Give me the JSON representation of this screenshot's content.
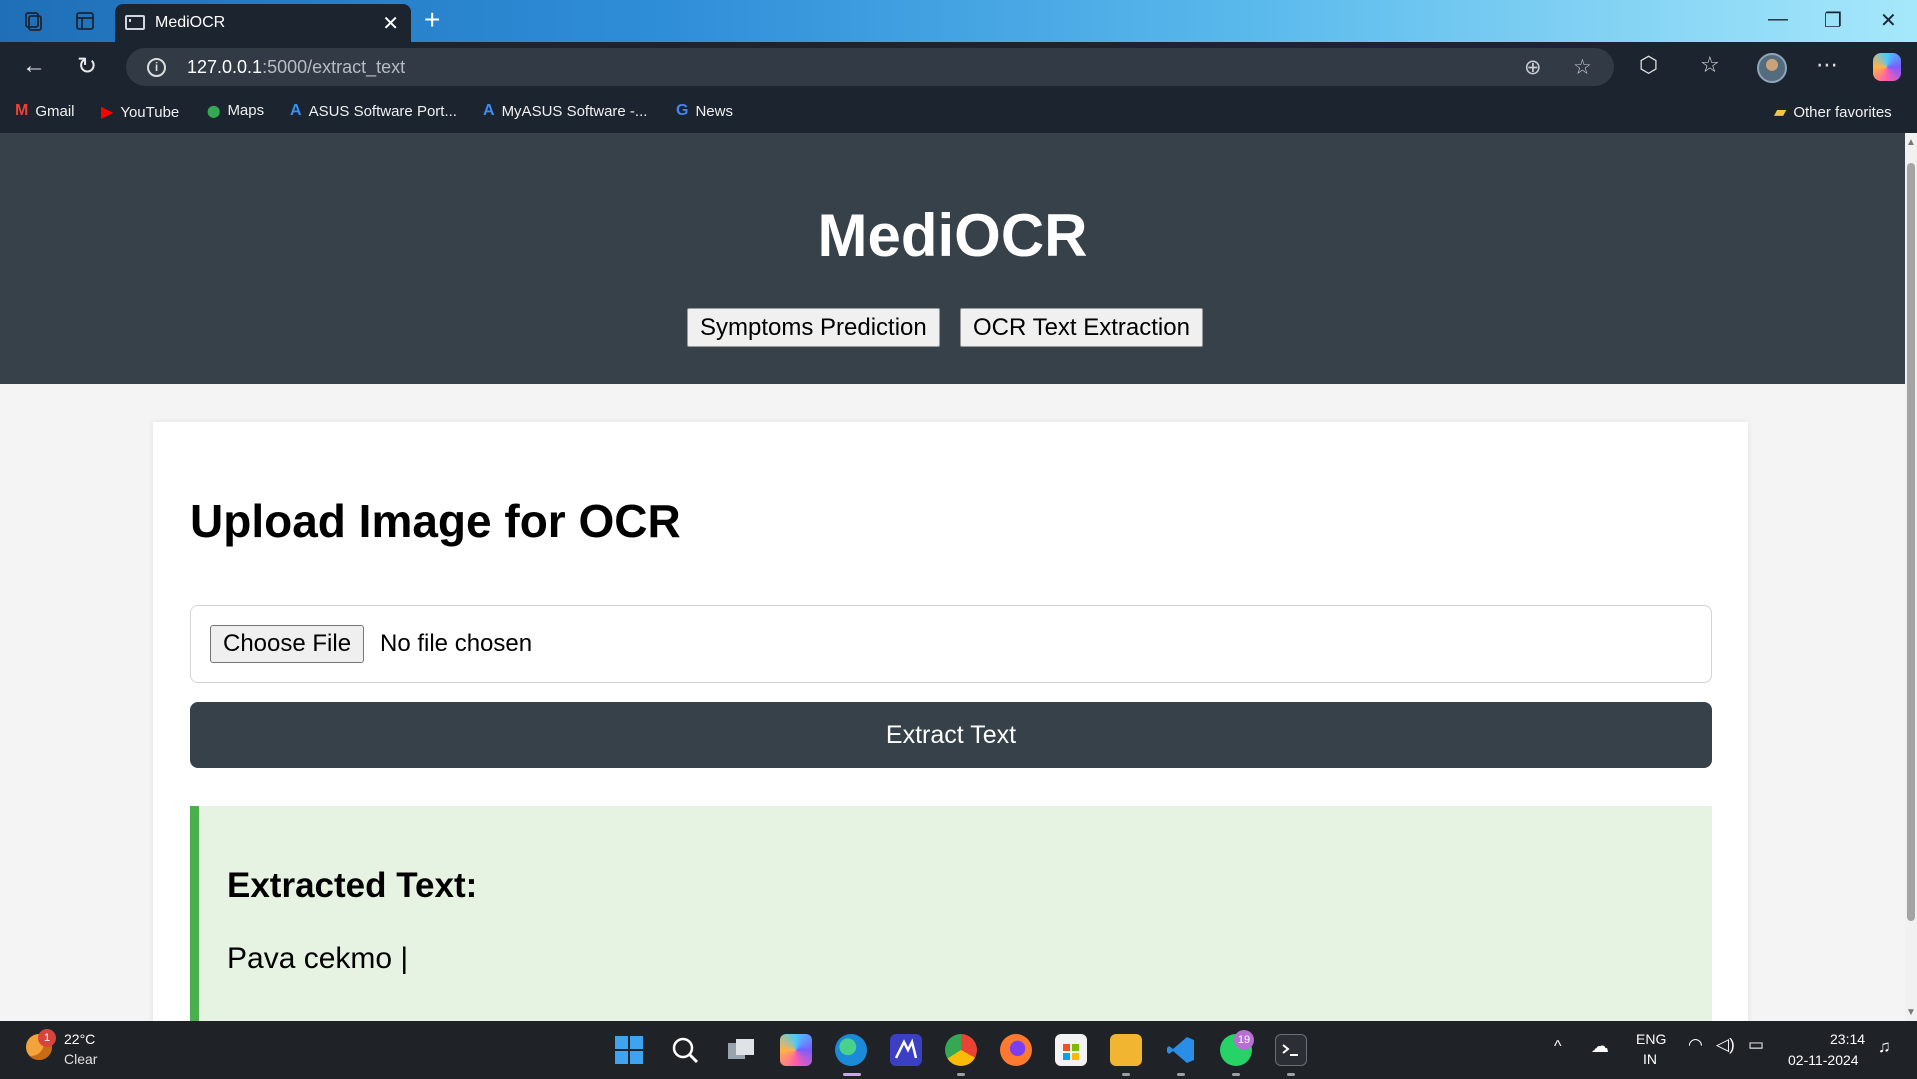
{
  "browser": {
    "tab_title": "MediOCR",
    "tab_close": "✕",
    "new_tab": "+",
    "url_host": "127.0.0.1",
    "url_path": ":5000/extract_text",
    "window_controls": {
      "minimize": "—",
      "restore": "❐",
      "close": "✕"
    },
    "bookmarks": [
      {
        "label": "Gmail",
        "icon": "gmail-icon",
        "glyph": "M",
        "color": "#ea4335"
      },
      {
        "label": "YouTube",
        "icon": "youtube-icon",
        "glyph": "▶",
        "color": "#ff0000"
      },
      {
        "label": "Maps",
        "icon": "maps-pin-icon",
        "glyph": "⬤",
        "color": "#34a853"
      },
      {
        "label": "ASUS Software Port...",
        "icon": "asus-icon",
        "glyph": "A",
        "color": "#3b8ff3"
      },
      {
        "label": "MyASUS Software -...",
        "icon": "myasus-icon",
        "glyph": "A",
        "color": "#3b8ff3"
      },
      {
        "label": "News",
        "icon": "google-news-icon",
        "glyph": "G",
        "color": "#4285f4"
      }
    ],
    "other_favorites": "Other favorites"
  },
  "page": {
    "app_title": "MediOCR",
    "nav": {
      "symptoms": "Symptoms Prediction",
      "ocr": "OCR Text Extraction"
    },
    "upload_heading": "Upload Image for OCR",
    "choose_file": "Choose File",
    "no_file": "No file chosen",
    "extract_button": "Extract Text",
    "result_heading": "Extracted Text:",
    "result_text": "Pava cekmo |"
  },
  "taskbar": {
    "weather_badge": "1",
    "temperature": "22°C",
    "condition": "Clear",
    "whatsapp_badge": "19",
    "language": "ENG",
    "region": "IN",
    "time": "23:14",
    "date": "02-11-2024"
  },
  "colors": {
    "header_bg": "#36414a",
    "accent_green": "#4cae4f",
    "result_bg": "#e7f3e2"
  }
}
